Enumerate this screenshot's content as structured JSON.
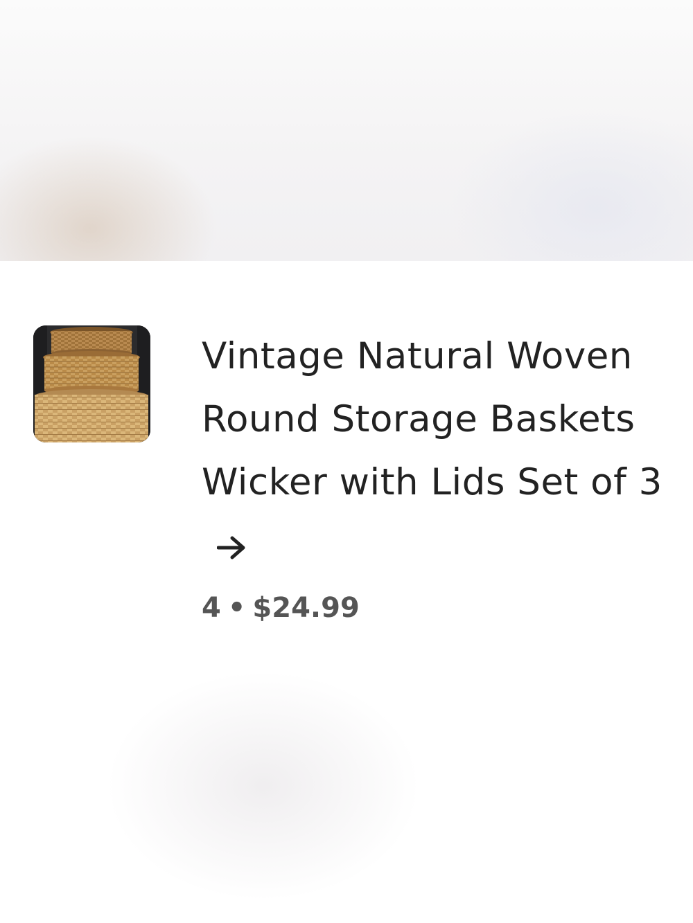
{
  "listing": {
    "title": "Vintage Natural Woven Round Storage Baskets Wicker with Lids Set of 3",
    "quantity": "4",
    "separator": "•",
    "price": "$24.99",
    "thumbnail_alt": "Stacked woven wicker baskets",
    "arrow_icon": "arrow-right-icon"
  }
}
